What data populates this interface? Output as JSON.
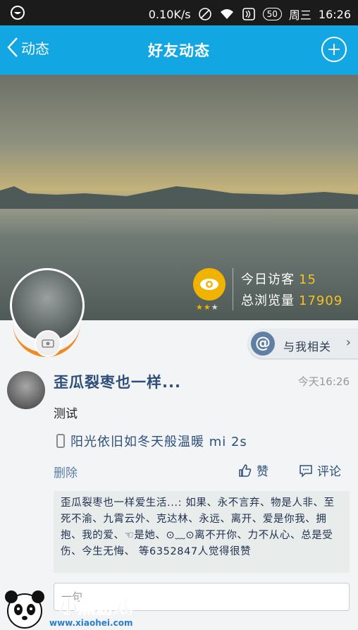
{
  "status_bar": {
    "network_speed": "0.10K/s",
    "battery": "50",
    "weekday": "周三",
    "time": "16:26",
    "icons": [
      "app-icon",
      "mute-icon",
      "wifi-icon",
      "nfc-icon",
      "battery-icon"
    ]
  },
  "nav": {
    "back_label": "动态",
    "title": "好友动态",
    "add_icon": "plus-icon"
  },
  "cover": {
    "visitors_label": "今日访客",
    "visitors_count": "15",
    "views_label": "总浏览量",
    "views_count": "17909",
    "stars_filled": 2,
    "stars_total": 3,
    "accent_color": "#f0b400"
  },
  "about_me": {
    "label": "与我相关",
    "icon": "at-icon"
  },
  "post": {
    "author": "歪瓜裂枣也一样...",
    "time": "今天16:26",
    "text": "测试",
    "device": "阳光依旧如冬天般温暖 mi 2s",
    "delete_label": "删除",
    "like_label": "赞",
    "comment_label": "评论",
    "likes_text": "歪瓜裂枣也一样爱生活...: 如果、永不言弃、物是人非、至死不渝、九霄云外、克达林、永远、离开、爱是你我、拥抱、我的爱、☜是她、⊙﹏⊙离不开你、力不从心、总是受伤、今生无悔、 等6352847人觉得很赞",
    "comment_placeholder": "一句..."
  },
  "watermark": {
    "brand": "小黑游戏",
    "url": "www.xiaohei.com"
  }
}
